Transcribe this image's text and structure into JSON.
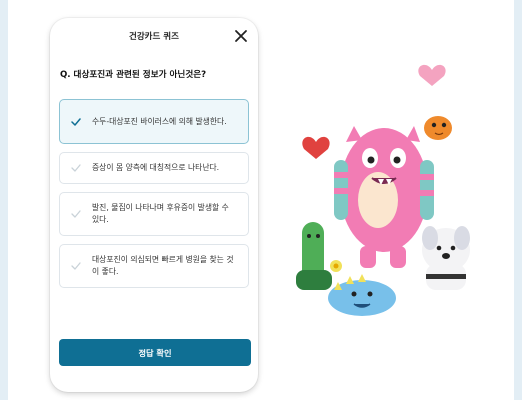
{
  "quiz": {
    "title": "건강카드 퀴즈",
    "question": "Q. 대상포진과 관련된 정보가 아닌것은?",
    "options": [
      {
        "label": "수두-대상포진 바이러스에 의해 발생한다.",
        "selected": true
      },
      {
        "label": "증상이 몸 양측에 대칭적으로 나타난다.",
        "selected": false
      },
      {
        "label": "발진, 물집이 나타나며 후유증이 발생할 수 있다.",
        "selected": false
      },
      {
        "label": "대상포진이 의심되면 빠르게 병원을 찾는 것이 좋다.",
        "selected": false
      }
    ],
    "submit_label": "정답 확인"
  },
  "icons": {
    "close": "close-icon",
    "check": "check-icon"
  },
  "colors": {
    "accent": "#0f6f94",
    "selected_bg": "#eef7fa",
    "selected_border": "#8cc3d4",
    "check_selected": "#0f6f94",
    "check_default": "#c9d2d8",
    "page_bg": "#e3eef5"
  }
}
